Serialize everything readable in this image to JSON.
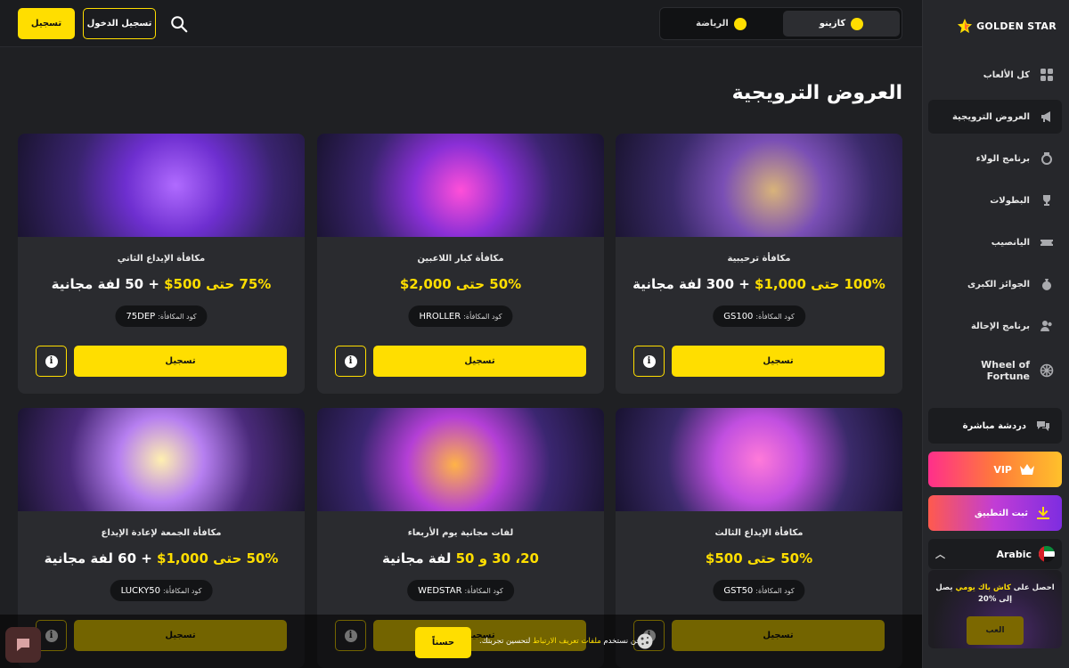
{
  "brand": {
    "name": "GOLDEN STAR"
  },
  "topbar": {
    "register_label": "تسجيل",
    "login_label": "تسجيل الدخول",
    "tabs": [
      {
        "label": "كازينو",
        "active": true
      },
      {
        "label": "الرياضة",
        "active": false
      }
    ]
  },
  "sidebar": {
    "items": [
      {
        "label": "كل الألعاب",
        "icon": "grid-icon"
      },
      {
        "label": "العروض الترويجية",
        "icon": "megaphone-icon",
        "active": true
      },
      {
        "label": "برنامج الولاء",
        "icon": "medal-icon"
      },
      {
        "label": "البطولات",
        "icon": "trophy-icon"
      },
      {
        "label": "اليانصيب",
        "icon": "ticket-icon"
      },
      {
        "label": "الجوائز الكبرى",
        "icon": "money-bag-icon"
      },
      {
        "label": "برنامج الإحالة",
        "icon": "users-icon"
      },
      {
        "label": "Wheel of Fortune",
        "icon": "wheel-icon"
      }
    ],
    "chat_label": "دردشة مباشرة",
    "vip_label": "VIP",
    "install_label": "ثبت التطبيق",
    "language_label": "Arabic",
    "cashback": {
      "text_before": "احصل على ",
      "highlight": "كاش باك يومي",
      "text_after": " يصل إلى %20",
      "button_label": "العب"
    }
  },
  "main": {
    "title": "العروض الترويجية",
    "code_label": "كود المكافأة:",
    "claim_label": "تسجيل",
    "cards": [
      {
        "title": "مكافأة ترحيبية",
        "offer_highlight": "100% حتى 1,000$",
        "offer_rest": " + 300 لفة مجانية",
        "code": "GS100"
      },
      {
        "title": "مكافأة كبار اللاعبين",
        "offer_highlight": "50% حتى 2,000$",
        "offer_rest": "",
        "code": "HROLLER"
      },
      {
        "title": "مكافأة الإيداع الثاني",
        "offer_highlight": "75% حتى 500$",
        "offer_rest": " + 50 لفة مجانية",
        "code": "75DEP"
      },
      {
        "title": "مكافأة الإيداع الثالث",
        "offer_highlight": "50% حتى 500$",
        "offer_rest": "",
        "code": "GST50"
      },
      {
        "title": "لفات مجانية يوم الأربعاء",
        "offer_highlight": "20، 30 و 50",
        "offer_rest": " لفة مجانية",
        "code": "WEDSTAR"
      },
      {
        "title": "مكافأة الجمعة لإعادة الإيداع",
        "offer_highlight": "50% حتى 1,000$",
        "offer_rest": " + 60 لفة مجانية",
        "code": "LUCKY50"
      }
    ]
  },
  "cookie": {
    "text_before": "نحن نستخدم ",
    "link": "ملفات تعريف الارتباط",
    "text_after": " لتحسين تجربتك.",
    "accept_label": "حسناً"
  },
  "colors": {
    "accent": "#ffde00",
    "background": "#1f2023",
    "card": "#2a2b2f"
  }
}
